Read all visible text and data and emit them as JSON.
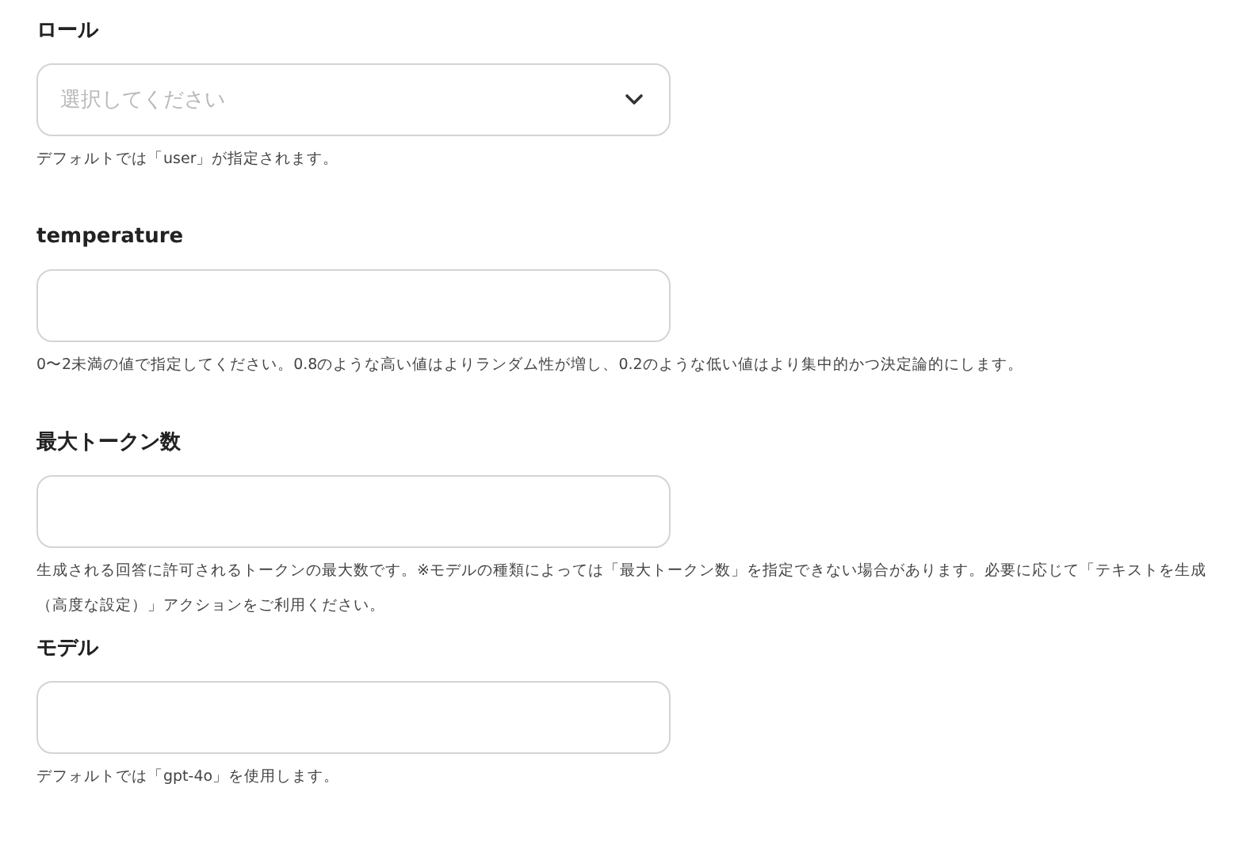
{
  "fields": [
    {
      "kind": "select",
      "label": "ロール",
      "placeholder": "選択してください",
      "help": "デフォルトでは「user」が指定されます。"
    },
    {
      "kind": "text",
      "label": "temperature",
      "help": "0〜2未満の値で指定してください。0.8のような高い値はよりランダム性が増し、0.2のような低い値はより集中的かつ決定論的にします。"
    },
    {
      "kind": "text",
      "label": "最大トークン数",
      "help": "生成される回答に許可されるトークンの最大数です。※モデルの種類によっては「最大トークン数」を指定できない場合があります。必要に応じて「テキストを生成（高度な設定）」アクションをご利用ください。"
    },
    {
      "kind": "text",
      "label": "モデル",
      "help": "デフォルトでは「gpt-4o」を使用します。"
    }
  ]
}
